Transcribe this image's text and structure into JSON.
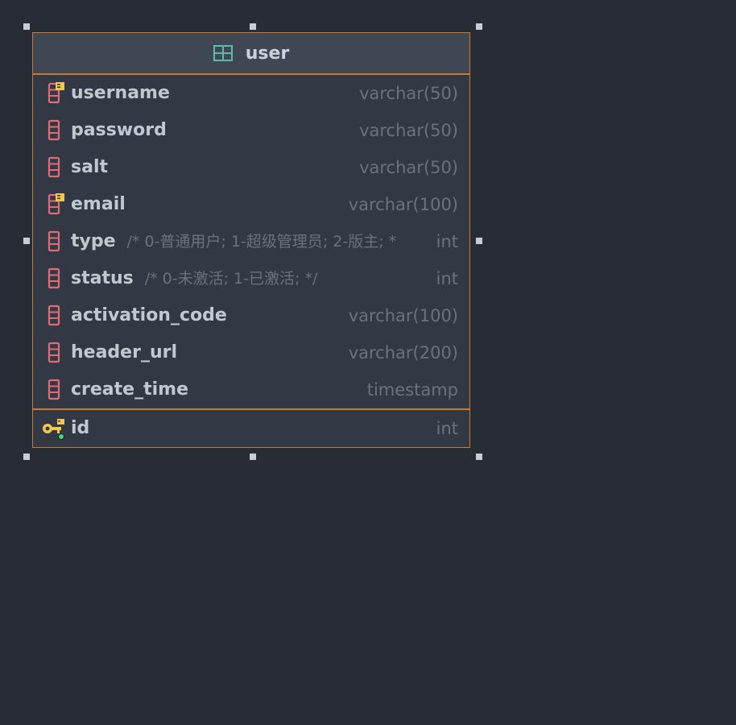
{
  "table": {
    "name": "user",
    "icon": "table-icon",
    "accent_color": "#c87a33",
    "columns": [
      {
        "name": "username",
        "type": "varchar(50)",
        "comment": "",
        "icon": "index-column-icon"
      },
      {
        "name": "password",
        "type": "varchar(50)",
        "comment": "",
        "icon": "column-icon"
      },
      {
        "name": "salt",
        "type": "varchar(50)",
        "comment": "",
        "icon": "column-icon"
      },
      {
        "name": "email",
        "type": "varchar(100)",
        "comment": "",
        "icon": "index-column-icon"
      },
      {
        "name": "type",
        "type": "int",
        "comment": "/* 0-普通用户; 1-超级管理员; 2-版主; *",
        "icon": "column-icon"
      },
      {
        "name": "status",
        "type": "int",
        "comment": "/* 0-未激活; 1-已激活; */",
        "icon": "column-icon"
      },
      {
        "name": "activation_code",
        "type": "varchar(100)",
        "comment": "",
        "icon": "column-icon"
      },
      {
        "name": "header_url",
        "type": "varchar(200)",
        "comment": "",
        "icon": "column-icon"
      },
      {
        "name": "create_time",
        "type": "timestamp",
        "comment": "",
        "icon": "column-icon"
      }
    ],
    "primary_key": {
      "name": "id",
      "type": "int",
      "icon": "primary-key-icon"
    }
  }
}
